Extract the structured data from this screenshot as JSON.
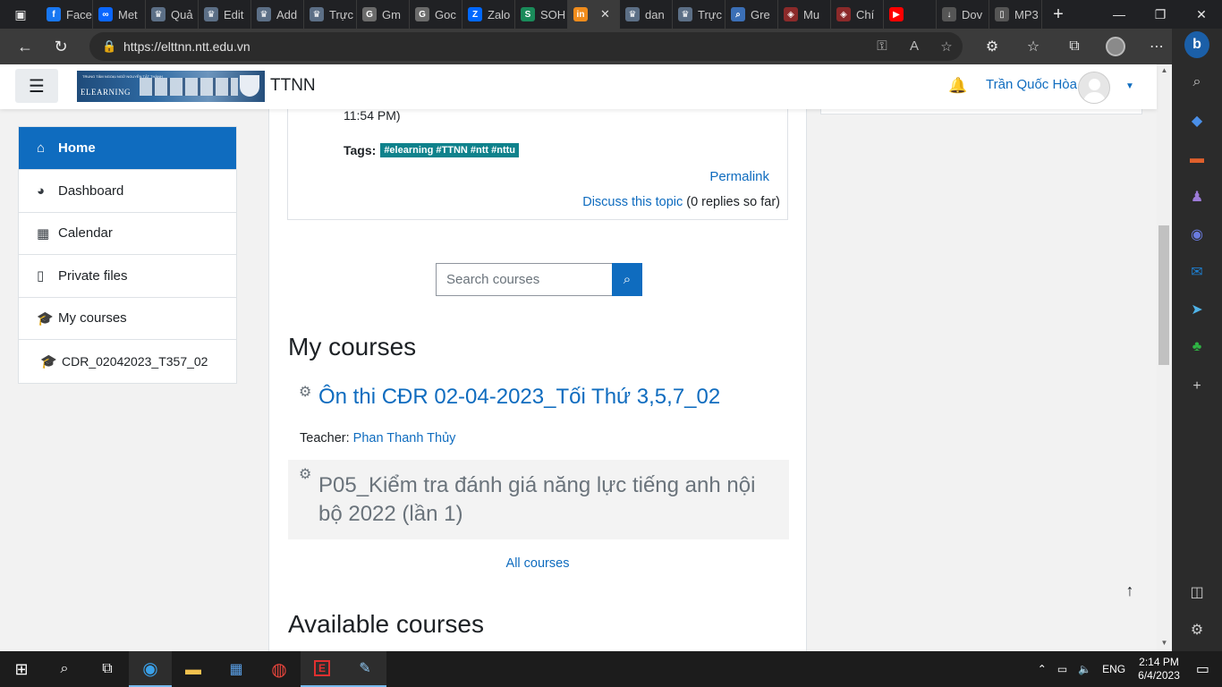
{
  "browser": {
    "tabs": [
      {
        "label": "Face",
        "color": "#1877f2",
        "glyph": "f"
      },
      {
        "label": "Met",
        "color": "#0a66ff",
        "glyph": "∞"
      },
      {
        "label": "Quả",
        "color": "#5c6f86",
        "glyph": "♛"
      },
      {
        "label": "Edit",
        "color": "#5c6f86",
        "glyph": "♛"
      },
      {
        "label": "Add",
        "color": "#5c6f86",
        "glyph": "♛"
      },
      {
        "label": "Trực",
        "color": "#5c6f86",
        "glyph": "♛"
      },
      {
        "label": "Gm",
        "color": "#6b6b6b",
        "glyph": "G"
      },
      {
        "label": "Goc",
        "color": "#6b6b6b",
        "glyph": "G"
      },
      {
        "label": "Zalo",
        "color": "#0068ff",
        "glyph": "Z"
      },
      {
        "label": "SOH",
        "color": "#1a8b5a",
        "glyph": "S"
      },
      {
        "label": "",
        "color": "#f08c1c",
        "glyph": "in",
        "active": true
      },
      {
        "label": "dan",
        "color": "#5c6f86",
        "glyph": "♛"
      },
      {
        "label": "Trực",
        "color": "#5c6f86",
        "glyph": "♛"
      },
      {
        "label": "Gre",
        "color": "#3b6fb6",
        "glyph": "⌕"
      },
      {
        "label": "Mu",
        "color": "#8b2a2a",
        "glyph": "◈"
      },
      {
        "label": "Chí",
        "color": "#8b2a2a",
        "glyph": "◈"
      },
      {
        "label": "",
        "color": "#ff0000",
        "glyph": "▶"
      },
      {
        "label": "Dov",
        "color": "#555555",
        "glyph": "↓"
      },
      {
        "label": "MP3",
        "color": "#555555",
        "glyph": "▯"
      }
    ],
    "url": "https://elttnn.ntt.edu.vn"
  },
  "header": {
    "logo_text": "ELEARNING",
    "logo_small": "TRUNG TÂM NGOẠI NGỮ NGUYỄN TẤT THÀNH",
    "site_name": "TTNN",
    "user_name": "Trần Quốc Hòa"
  },
  "nav": {
    "home": "Home",
    "dashboard": "Dashboard",
    "calendar": "Calendar",
    "private_files": "Private files",
    "my_courses": "My courses",
    "course_link": "CDR_02042023_T357_02"
  },
  "post": {
    "time_tail": "11:54 PM)",
    "tags_label": "Tags:",
    "tags": "#elearning #TTNN #ntt #nttu",
    "permalink": "Permalink",
    "discuss": "Discuss this topic",
    "replies": "(0 replies so far)"
  },
  "search": {
    "placeholder": "Search courses"
  },
  "my_courses": {
    "heading": "My courses",
    "courses": [
      {
        "title": "Ôn thi CĐR 02-04-2023_Tối Thứ 3,5,7_02",
        "teacher_label": "Teacher:",
        "teacher": "Phan Thanh Thủy"
      },
      {
        "title": "P05_Kiểm tra đánh giá năng lực tiếng anh nội bộ 2022 (lần 1)"
      }
    ],
    "all_courses": "All courses"
  },
  "available_courses": {
    "heading": "Available courses"
  },
  "taskbar": {
    "language": "ENG",
    "time": "2:14 PM",
    "date": "6/4/2023"
  },
  "colors": {
    "primary": "#0f6cbf",
    "tag": "#0f828c"
  }
}
